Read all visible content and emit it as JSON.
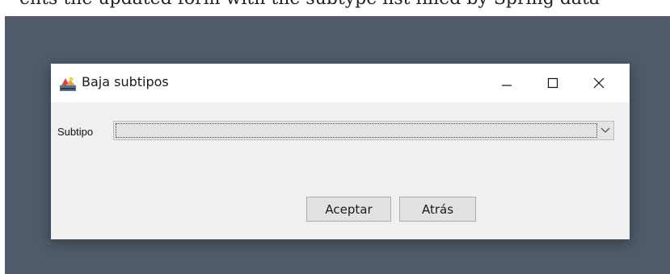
{
  "background_page": {
    "cut_off_text": "ents the updated form with the subtype list filled by Spring data"
  },
  "window": {
    "title": "Baja subtipos",
    "icon": "java-app-icon",
    "controls": {
      "minimize": "minimize-icon",
      "maximize": "maximize-icon",
      "close": "close-icon"
    }
  },
  "form": {
    "subtipo_label": "Subtipo",
    "subtipo_value": "",
    "accept_label": "Aceptar",
    "back_label": "Atrás"
  },
  "colors": {
    "desktop": "#4f5b69",
    "window_body": "#f0f0f0",
    "titlebar": "#ffffff"
  }
}
